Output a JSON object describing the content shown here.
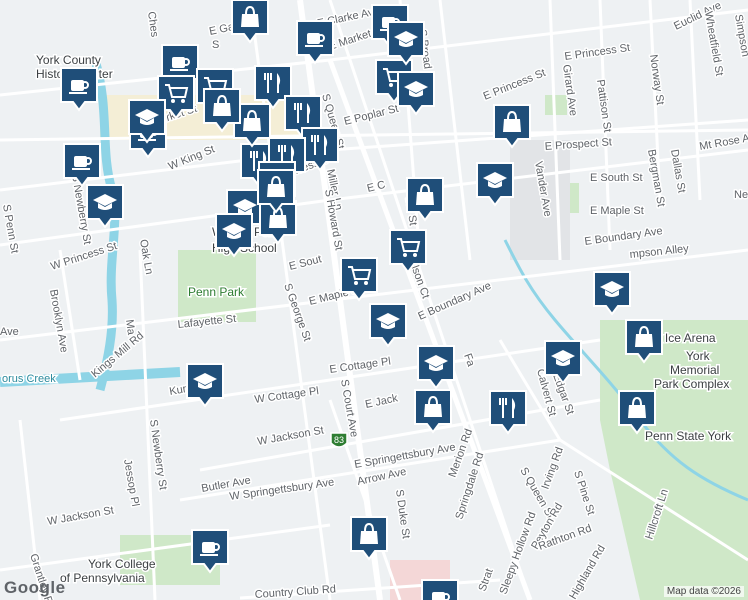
{
  "map": {
    "attribution": "Map data ©2026",
    "logo": "Google",
    "highway_shield": "83",
    "streets": [
      {
        "id": "s-queen-st",
        "text": "S Queen St"
      },
      {
        "id": "s-queen-st-2",
        "text": "S Queen St"
      },
      {
        "id": "e-princess-st",
        "text": "E Princess St"
      },
      {
        "id": "e-princess-st-2",
        "text": "E Princess St"
      },
      {
        "id": "w-princess-st",
        "text": "W Princess St"
      },
      {
        "id": "princess-st-center",
        "text": "Princess St"
      },
      {
        "id": "w-market-st",
        "text": "W Market St"
      },
      {
        "id": "e-market-st",
        "text": "E Market St"
      },
      {
        "id": "e-gas-ave",
        "text": "E Gas Ave"
      },
      {
        "id": "e-clarke-ave",
        "text": "E Clarke Ave"
      },
      {
        "id": "e-poplar-st",
        "text": "E Poplar St"
      },
      {
        "id": "w-king-st",
        "text": "W King St"
      },
      {
        "id": "e-prospect-st",
        "text": "E Prospect St"
      },
      {
        "id": "mt-rose-ave",
        "text": "Mt Rose Av"
      },
      {
        "id": "e-south-st",
        "text": "E South St"
      },
      {
        "id": "e-south-st-2",
        "text": "E Sout"
      },
      {
        "id": "e-maple-st",
        "text": "E Maple St"
      },
      {
        "id": "e-maple-st-2",
        "text": "E Maple S"
      },
      {
        "id": "e-boundary-ave",
        "text": "E Boundary Ave"
      },
      {
        "id": "e-boundary-ave-2",
        "text": "E Boundary Ave"
      },
      {
        "id": "simpson-alley",
        "text": "mpson Alley"
      },
      {
        "id": "w-cottage-pl",
        "text": "W Cottage Pl"
      },
      {
        "id": "e-cottage-pl",
        "text": "E Cottage Pl"
      },
      {
        "id": "w-jackson-st",
        "text": "W Jackson St"
      },
      {
        "id": "w-jackson-st-2",
        "text": "W Jackson St"
      },
      {
        "id": "e-jackson-st",
        "text": "E Jack"
      },
      {
        "id": "e-springettsbury-ave",
        "text": "E Springettsbury Ave"
      },
      {
        "id": "w-springettsbury-ave",
        "text": "W Springettsbury Ave"
      },
      {
        "id": "arrow-ave",
        "text": "Arrow Ave"
      },
      {
        "id": "butler-ave",
        "text": "Butler Ave"
      },
      {
        "id": "kurtz-ave",
        "text": "Kurtz Ave"
      },
      {
        "id": "lafayette-st",
        "text": "Lafayette St"
      },
      {
        "id": "kings-mill-rd",
        "text": "Kings Mill Rd"
      },
      {
        "id": "s-george-st",
        "text": "S George St"
      },
      {
        "id": "s-court-ave",
        "text": "S Court Ave"
      },
      {
        "id": "s-duke-st",
        "text": "S Duke St"
      },
      {
        "id": "miller-ln",
        "text": "Miller Ln"
      },
      {
        "id": "s-howard-st",
        "text": "S Howard St"
      },
      {
        "id": "wilson-ct",
        "text": "Wilson Ct"
      },
      {
        "id": "s-broad-st",
        "text": "S Broad St"
      },
      {
        "id": "s-pine-st",
        "text": "S Pine St"
      },
      {
        "id": "s-pine-st-top",
        "text": "ine St"
      },
      {
        "id": "girard-ave",
        "text": "Girard Ave"
      },
      {
        "id": "pattison-st",
        "text": "Pattison St"
      },
      {
        "id": "norway-st",
        "text": "Norway St"
      },
      {
        "id": "euclid-ave",
        "text": "Euclid Ave"
      },
      {
        "id": "wheatfield-st",
        "text": "Wheatfield St"
      },
      {
        "id": "simpson-st",
        "text": "Simpson"
      },
      {
        "id": "vander-ave",
        "text": "Vander Ave"
      },
      {
        "id": "bergman-st",
        "text": "Bergman St"
      },
      {
        "id": "dallas-st",
        "text": "Dallas St"
      },
      {
        "id": "nes",
        "text": "Nes"
      },
      {
        "id": "calvert-st",
        "text": "Calvert St"
      },
      {
        "id": "edgar-st",
        "text": "Edgar St"
      },
      {
        "id": "fa",
        "text": "Fa"
      },
      {
        "id": "merion-rd",
        "text": "Merion Rd"
      },
      {
        "id": "springdale-rd",
        "text": "Springdale Rd"
      },
      {
        "id": "irving-rd",
        "text": "Irving Rd"
      },
      {
        "id": "peyton-rd",
        "text": "Peyton Rd"
      },
      {
        "id": "rathton-rd",
        "text": "Rathton Rd"
      },
      {
        "id": "sleepy-hollow-rd",
        "text": "Sleepy Hollow Rd"
      },
      {
        "id": "highland-rd",
        "text": "Highland Rd"
      },
      {
        "id": "hillcroft-ln",
        "text": "Hillcroft Ln"
      },
      {
        "id": "country-club-rd",
        "text": "Country Club Rd"
      },
      {
        "id": "grantley-rd",
        "text": "Grantley Rd"
      },
      {
        "id": "jessop-pl",
        "text": "Jessop Pl"
      },
      {
        "id": "s-newberry-st",
        "text": "S Newberry St"
      },
      {
        "id": "s-newberry-st-2",
        "text": "S Newberry St"
      },
      {
        "id": "brooklyn-ave",
        "text": "Brooklyn Ave"
      },
      {
        "id": "oak-ln",
        "text": "Oak Ln"
      },
      {
        "id": "s-penn-st",
        "text": "S Penn St"
      },
      {
        "id": "ma-partial",
        "text": "Ma"
      },
      {
        "id": "ave-partial",
        "text": "Ave"
      },
      {
        "id": "s-partial",
        "text": "S"
      },
      {
        "id": "e-co-partial",
        "text": "E C"
      },
      {
        "id": "strat-partial",
        "text": "Strat"
      },
      {
        "id": "ches-partial",
        "text": "Ches"
      },
      {
        "id": "w-ja-partial",
        "text": "W Jackson St"
      }
    ],
    "places": [
      {
        "id": "william-penn-hs-1",
        "text": "William Penn"
      },
      {
        "id": "william-penn-hs-2",
        "text": "High School"
      },
      {
        "id": "penn-park",
        "text": "Penn Park"
      },
      {
        "id": "york-county-history-1",
        "text": "York County"
      },
      {
        "id": "york-county-history-2",
        "text": "History Center"
      },
      {
        "id": "york-ice-arena",
        "text": "York Ice Arena"
      },
      {
        "id": "york-memorial-1",
        "text": "York"
      },
      {
        "id": "york-memorial-2",
        "text": "Memorial"
      },
      {
        "id": "york-memorial-3",
        "text": "Park Complex"
      },
      {
        "id": "penn-state-york",
        "text": "Penn State York"
      },
      {
        "id": "york-college-1",
        "text": "York College"
      },
      {
        "id": "york-college-2",
        "text": "of Pennsylvania"
      },
      {
        "id": "codorus-creek",
        "text": "orus Creek"
      }
    ],
    "markers": [
      {
        "id": "cafe-1",
        "icon": "coffee-cup-icon"
      },
      {
        "id": "cafe-2",
        "icon": "coffee-cup-icon"
      },
      {
        "id": "cafe-3",
        "icon": "coffee-cup-icon"
      },
      {
        "id": "cafe-4",
        "icon": "coffee-cup-icon"
      },
      {
        "id": "cafe-5",
        "icon": "coffee-cup-icon"
      },
      {
        "id": "cafe-6",
        "icon": "coffee-cup-icon"
      },
      {
        "id": "cafe-7",
        "icon": "coffee-cup-icon"
      },
      {
        "id": "cafe-8",
        "icon": "coffee-cup-icon"
      },
      {
        "id": "grocery-1",
        "icon": "shopping-cart-icon"
      },
      {
        "id": "grocery-2",
        "icon": "shopping-cart-icon"
      },
      {
        "id": "grocery-3",
        "icon": "shopping-cart-icon"
      },
      {
        "id": "grocery-4",
        "icon": "shopping-cart-icon"
      },
      {
        "id": "grocery-5",
        "icon": "shopping-cart-icon"
      },
      {
        "id": "restaurant-1",
        "icon": "fork-knife-icon"
      },
      {
        "id": "restaurant-2",
        "icon": "fork-knife-icon"
      },
      {
        "id": "restaurant-3",
        "icon": "fork-knife-icon"
      },
      {
        "id": "restaurant-4",
        "icon": "fork-knife-icon"
      },
      {
        "id": "restaurant-5",
        "icon": "fork-knife-icon"
      },
      {
        "id": "restaurant-6",
        "icon": "fork-knife-icon"
      },
      {
        "id": "restaurant-7",
        "icon": "fork-knife-icon"
      },
      {
        "id": "school-1",
        "icon": "graduation-cap-icon"
      },
      {
        "id": "school-2",
        "icon": "graduation-cap-icon"
      },
      {
        "id": "school-3",
        "icon": "graduation-cap-icon"
      },
      {
        "id": "school-4",
        "icon": "graduation-cap-icon"
      },
      {
        "id": "school-5",
        "icon": "graduation-cap-icon"
      },
      {
        "id": "school-6",
        "icon": "graduation-cap-icon"
      },
      {
        "id": "school-7",
        "icon": "graduation-cap-icon"
      },
      {
        "id": "school-8",
        "icon": "graduation-cap-icon"
      },
      {
        "id": "school-9",
        "icon": "graduation-cap-icon"
      },
      {
        "id": "school-10",
        "icon": "graduation-cap-icon"
      },
      {
        "id": "school-11",
        "icon": "graduation-cap-icon"
      },
      {
        "id": "school-12",
        "icon": "graduation-cap-icon"
      },
      {
        "id": "shop-1",
        "icon": "shopping-bag-icon"
      },
      {
        "id": "shop-2",
        "icon": "shopping-bag-icon"
      },
      {
        "id": "shop-3",
        "icon": "shopping-bag-icon"
      },
      {
        "id": "shop-4",
        "icon": "shopping-bag-icon"
      },
      {
        "id": "shop-5",
        "icon": "shopping-bag-icon"
      },
      {
        "id": "shop-6",
        "icon": "shopping-bag-icon"
      },
      {
        "id": "shop-7",
        "icon": "shopping-bag-icon"
      },
      {
        "id": "shop-8",
        "icon": "shopping-bag-icon"
      },
      {
        "id": "shop-9",
        "icon": "shopping-bag-icon"
      },
      {
        "id": "shop-10",
        "icon": "shopping-bag-icon"
      },
      {
        "id": "shop-11",
        "icon": "shopping-bag-icon"
      }
    ]
  }
}
